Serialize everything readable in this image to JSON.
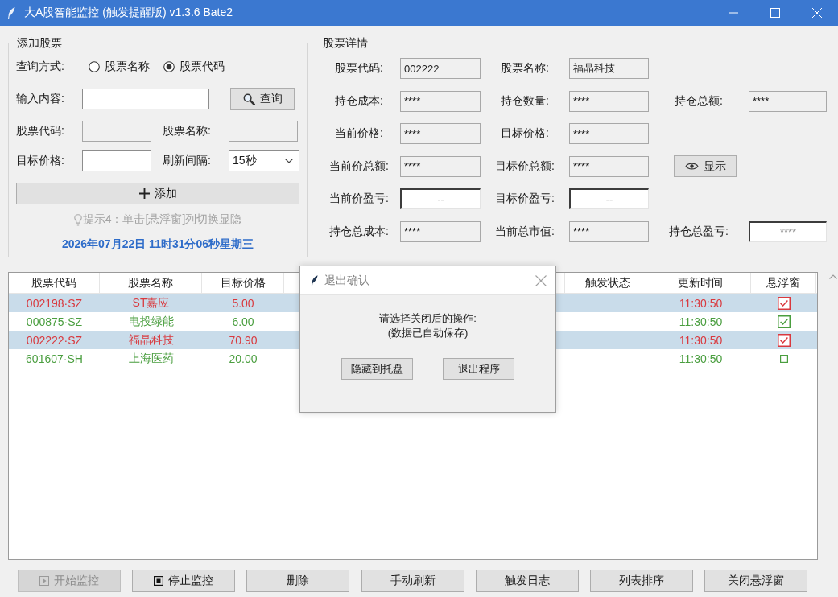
{
  "window": {
    "title": "大A股智能监控 (触发提醒版) v1.3.6 Bate2"
  },
  "add_stock": {
    "title": "添加股票",
    "query_mode": {
      "label": "查询方式:",
      "options": [
        {
          "label": "股票名称",
          "selected": false
        },
        {
          "label": "股票代码",
          "selected": true
        }
      ]
    },
    "input": {
      "label": "输入内容:",
      "readonly": false
    },
    "query_button": "查询",
    "code": {
      "label": "股票代码:",
      "readonly": true
    },
    "name": {
      "label": "股票名称:",
      "readonly": true
    },
    "target_price": {
      "label": "目标价格:",
      "readonly": false
    },
    "refresh_interval": {
      "label": "刷新间隔:",
      "value": "15秒"
    },
    "add_button": "添加",
    "hint": "提示4：单击[悬浮窗]列切换显隐",
    "datetime": "2026年07月22日 11时31分06秒星期三"
  },
  "stock_details": {
    "title": "股票详情",
    "rows": [
      [
        {
          "kind": "readonly",
          "label": "股票代码:",
          "value": "002222",
          "muted": false
        },
        {
          "kind": "readonly",
          "label": "股票名称:",
          "value": "福晶科技",
          "muted": false
        }
      ],
      [
        {
          "kind": "readonly",
          "label": "持仓成本:",
          "value": "****",
          "muted": false
        },
        {
          "kind": "readonly",
          "label": "持仓数量:",
          "value": "****",
          "muted": false
        },
        {
          "kind": "readonly",
          "label": "持仓总额:",
          "value": "****",
          "muted": false
        }
      ],
      [
        {
          "kind": "readonly",
          "label": "当前价格:",
          "value": "****",
          "muted": false
        },
        {
          "kind": "readonly",
          "label": "目标价格:",
          "value": "****",
          "muted": false
        }
      ],
      [
        {
          "kind": "readonly",
          "label": "当前价总额:",
          "value": "****",
          "muted": false
        },
        {
          "kind": "readonly",
          "label": "目标价总额:",
          "value": "****",
          "muted": false
        },
        {
          "kind": "button",
          "label": "显示"
        }
      ],
      [
        {
          "kind": "result",
          "label": "当前价盈亏:",
          "value": "--",
          "muted": false
        },
        {
          "kind": "result",
          "label": "目标价盈亏:",
          "value": "--",
          "muted": false
        }
      ],
      [
        {
          "kind": "readonly",
          "label": "持仓总成本:",
          "value": "****",
          "muted": false
        },
        {
          "kind": "readonly",
          "label": "当前总市值:",
          "value": "****",
          "muted": false
        },
        {
          "kind": "result",
          "label": "持仓总盈亏:",
          "value": "****",
          "muted": true
        }
      ]
    ]
  },
  "table": {
    "columns": [
      "股票代码",
      "股票名称",
      "目标价格",
      "触发状态",
      "更新时间",
      "悬浮窗"
    ],
    "rows": [
      {
        "code": "002198·SZ",
        "name": "ST嘉应",
        "target_price": "5.00",
        "update_time": "11:30:50",
        "floating": true,
        "selected": true,
        "color": "#d9393e"
      },
      {
        "code": "000875·SZ",
        "name": "电投绿能",
        "target_price": "6.00",
        "update_time": "11:30:50",
        "floating": true,
        "selected": false,
        "color": "#4a9e3f"
      },
      {
        "code": "002222·SZ",
        "name": "福晶科技",
        "target_price": "70.90",
        "update_time": "11:30:50",
        "floating": true,
        "selected": true,
        "color": "#d9393e"
      },
      {
        "code": "601607·SH",
        "name": "上海医药",
        "target_price": "20.00",
        "update_time": "11:30:50",
        "floating": false,
        "selected": false,
        "color": "#4a9e3f"
      }
    ]
  },
  "dialog": {
    "title": "退出确认",
    "message": [
      "请选择关闭后的操作:",
      "(数据已自动保存)"
    ],
    "buttons": [
      "隐藏到托盘",
      "退出程序"
    ]
  },
  "buttons": [
    {
      "label": "开始监控",
      "kind": "start",
      "disabled": true
    },
    {
      "label": "停止监控",
      "kind": "stop",
      "disabled": false
    },
    {
      "label": "删除",
      "kind": "plain",
      "disabled": false
    },
    {
      "label": "手动刷新",
      "kind": "plain",
      "disabled": false
    },
    {
      "label": "触发日志",
      "kind": "plain",
      "disabled": false
    },
    {
      "label": "列表排序",
      "kind": "plain",
      "disabled": false
    },
    {
      "label": "关闭悬浮窗",
      "kind": "plain",
      "disabled": false
    }
  ]
}
